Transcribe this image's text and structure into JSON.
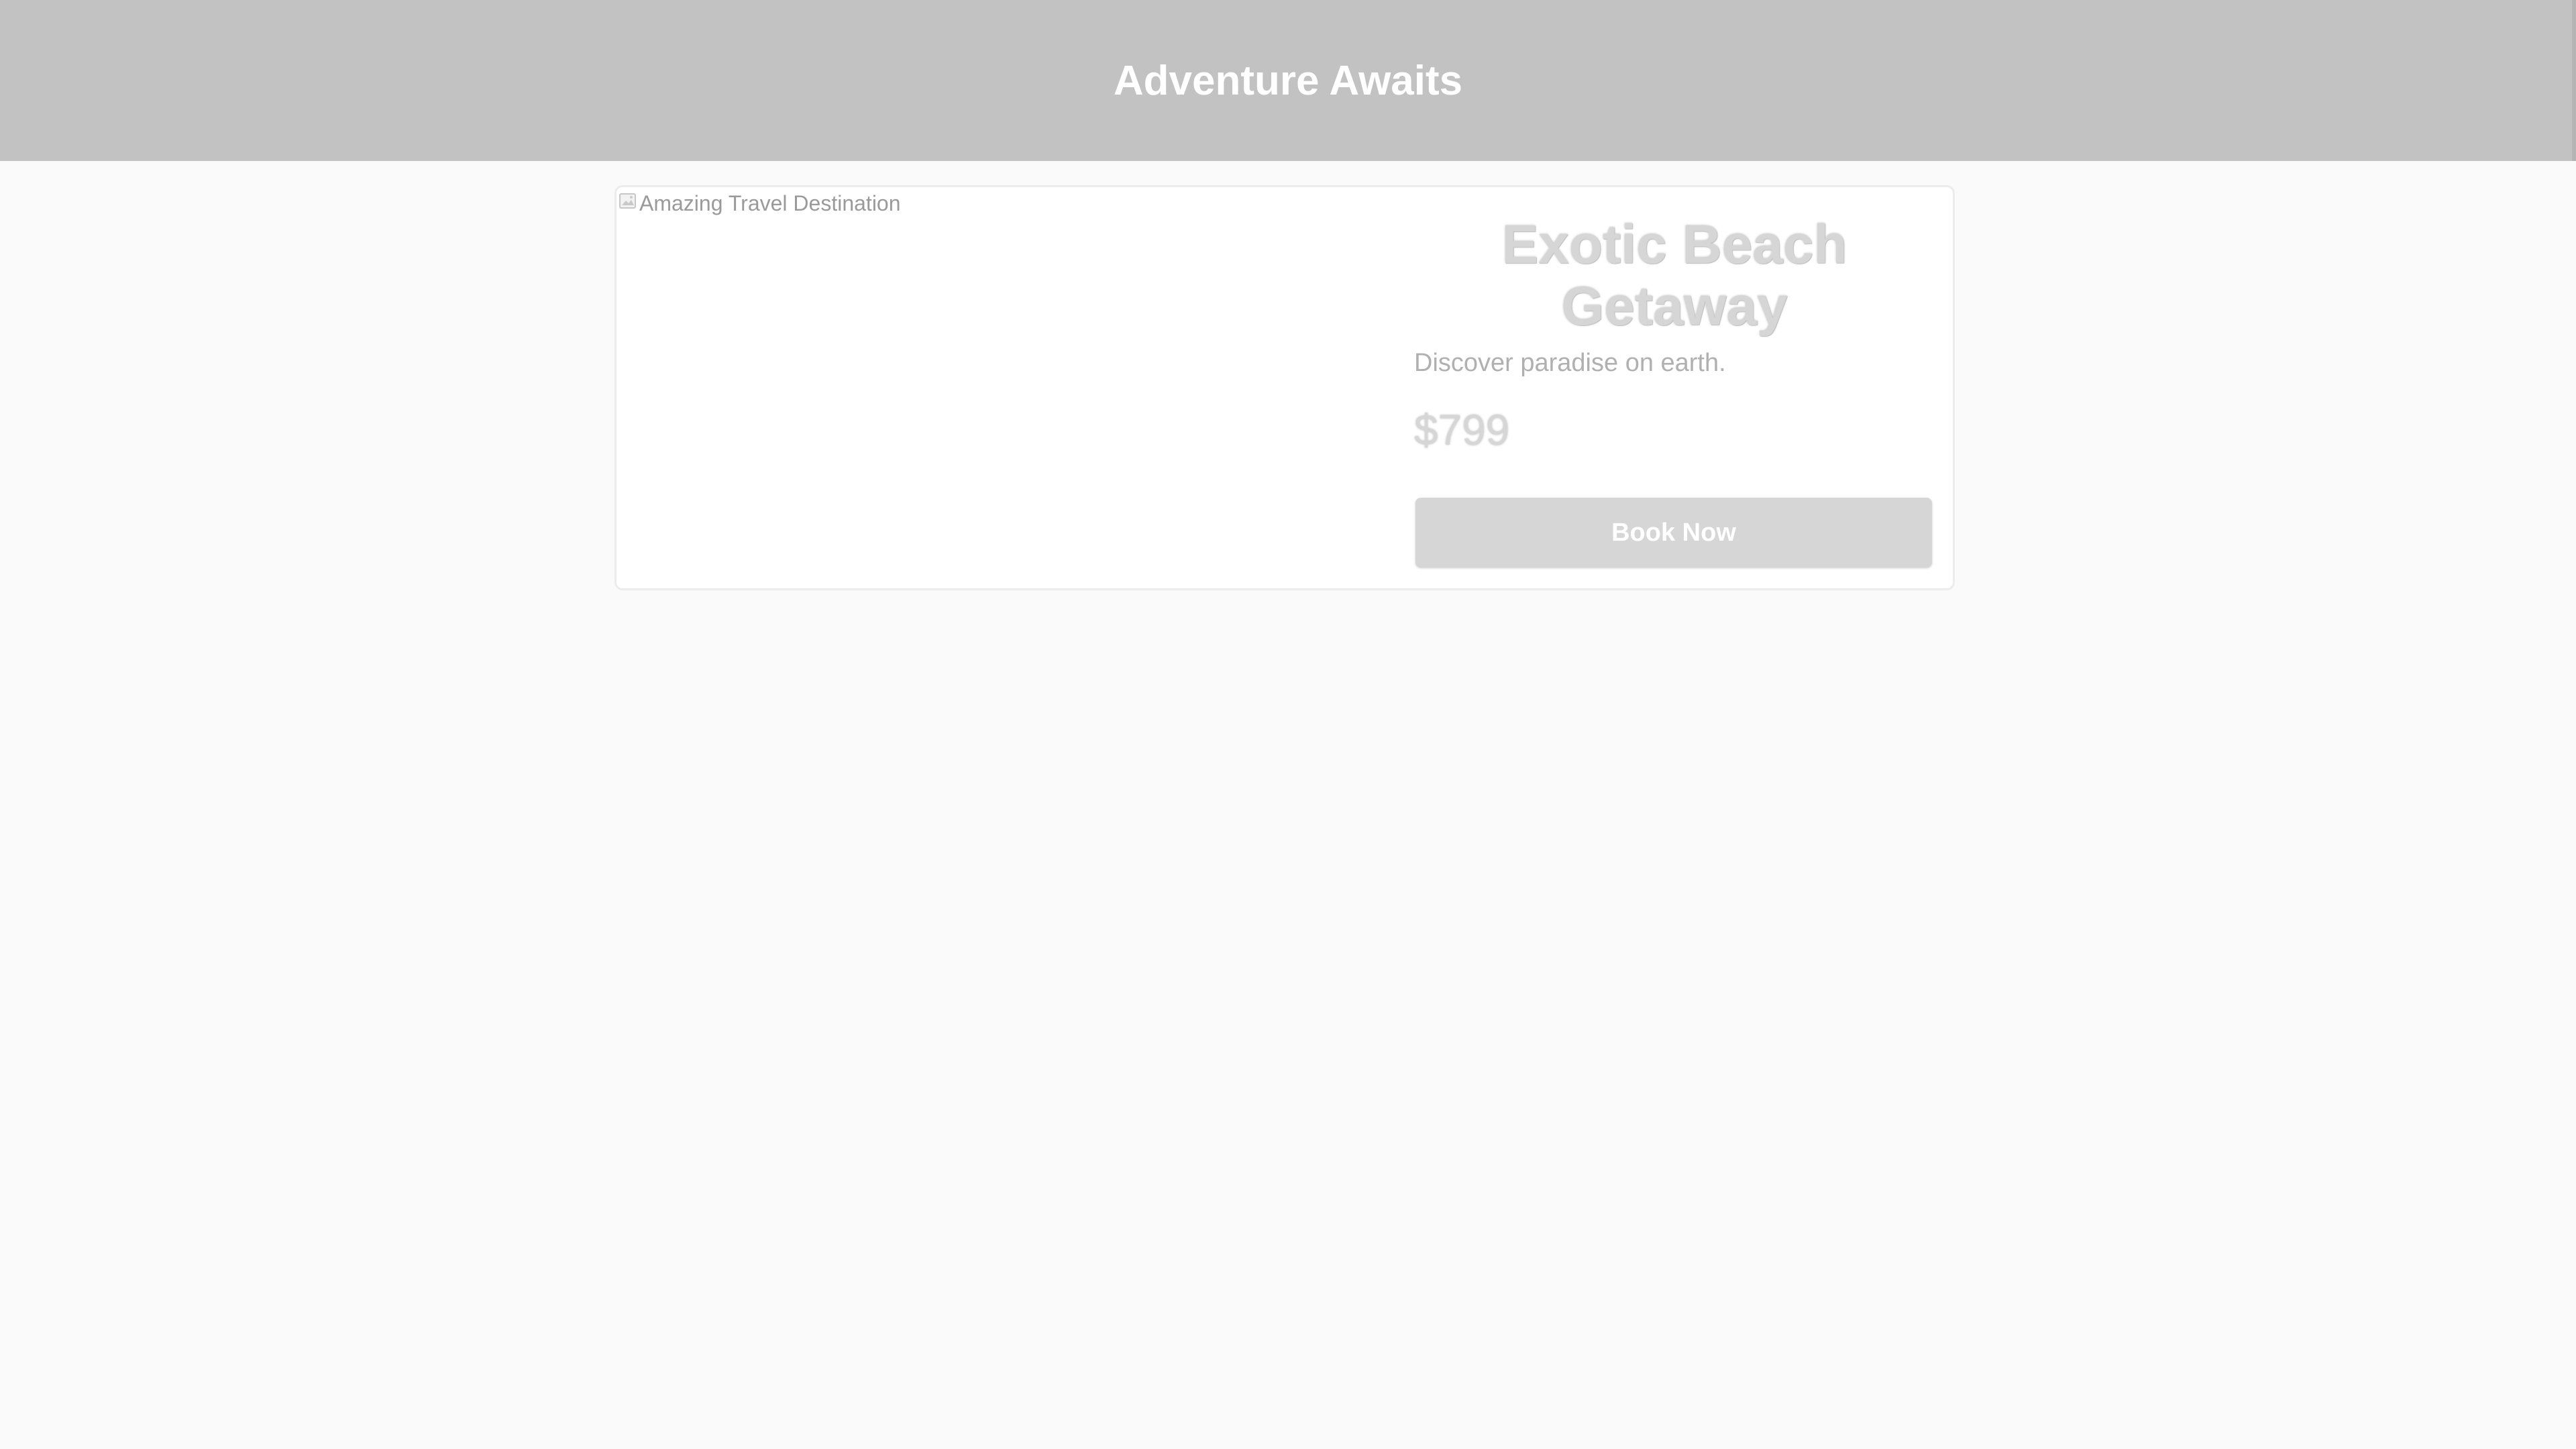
{
  "header": {
    "title": "Adventure Awaits"
  },
  "card": {
    "image_alt": "Amazing Travel Destination",
    "image_icon": "broken-image-icon",
    "title": "Exotic Beach Getaway",
    "subtitle": "Discover paradise on earth.",
    "price": "$799",
    "book_label": "Book Now"
  },
  "colors": {
    "header_bg": "#c2c2c2",
    "page_bg": "#fafafa",
    "button_bg": "#d6d6d6",
    "title_text": "#ffffff"
  }
}
